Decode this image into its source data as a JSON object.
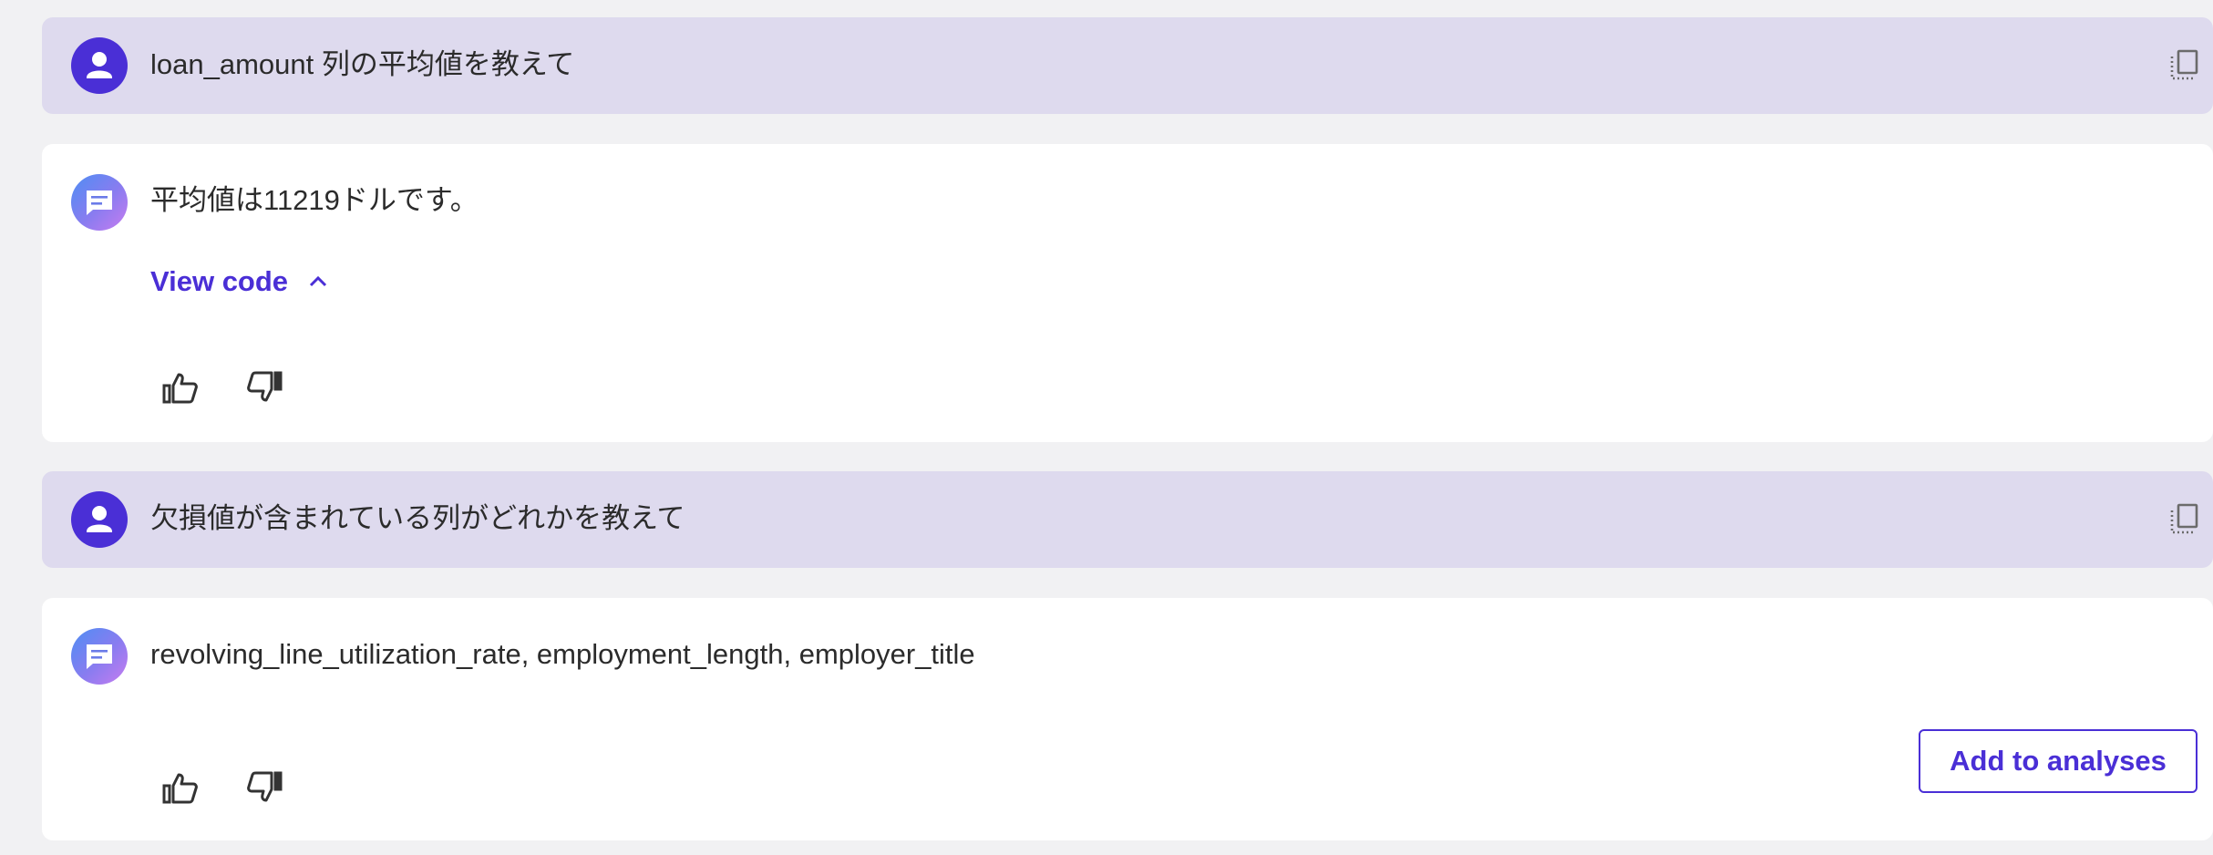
{
  "messages": [
    {
      "role": "user",
      "text": "loan_amount 列の平均値を教えて"
    },
    {
      "role": "assistant",
      "text": "平均値は11219ドルです。",
      "view_code_label": "View code"
    },
    {
      "role": "user",
      "text": "欠損値が含まれている列がどれかを教えて"
    },
    {
      "role": "assistant",
      "text": "revolving_line_utilization_rate, employment_length, employer_title",
      "action_label": "Add to analyses"
    }
  ],
  "colors": {
    "accent": "#4a2fd6",
    "user_bubble": "#dedaee",
    "assistant_bubble": "#ffffff",
    "background": "#f1f1f3"
  },
  "icons": [
    "user-avatar-icon",
    "assistant-chat-icon",
    "copy-icon",
    "chevron-up-icon",
    "thumbs-up-icon",
    "thumbs-down-icon"
  ]
}
